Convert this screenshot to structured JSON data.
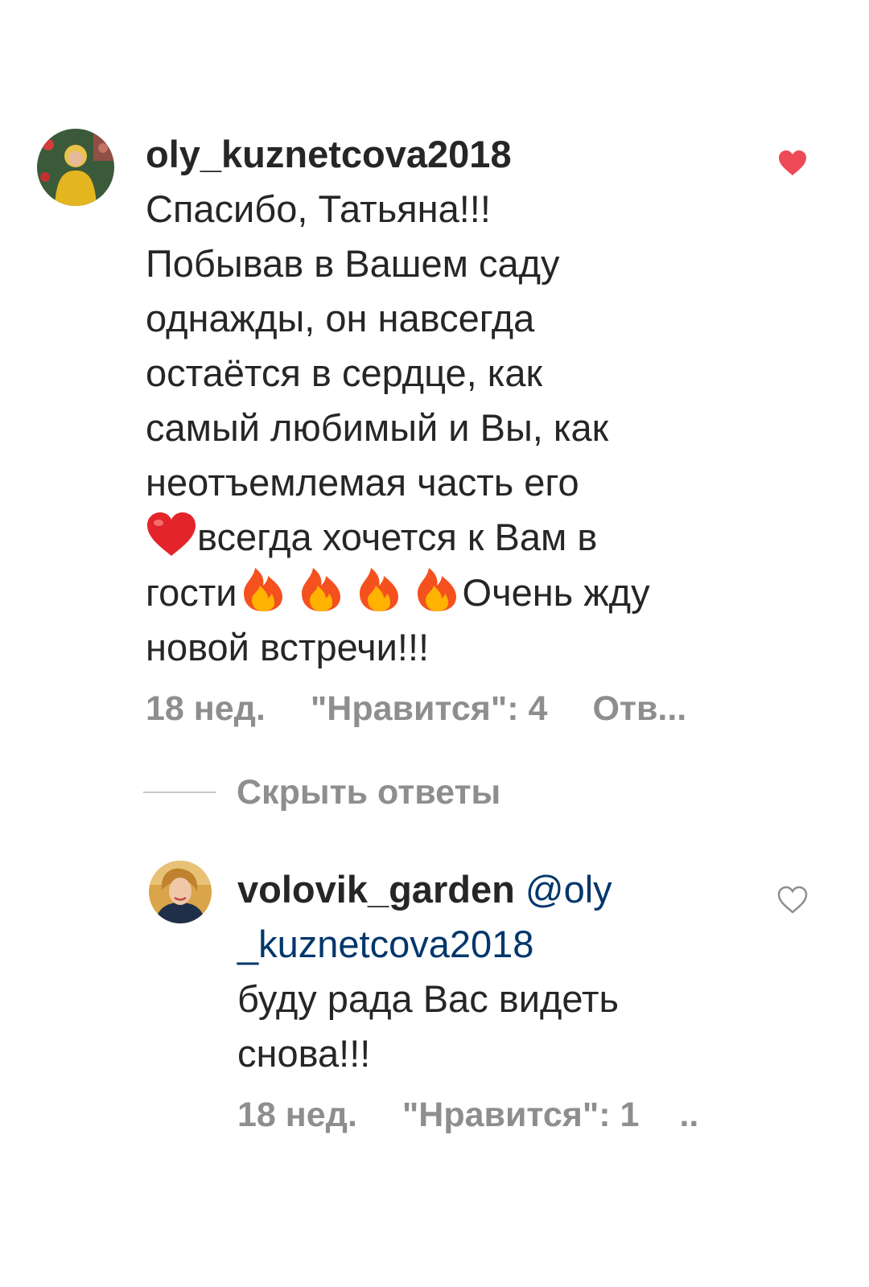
{
  "comments": [
    {
      "username": "oly_kuznetcova2018",
      "lines": [
        "Спасибо, Татьяна!!!",
        "Побывав в Вашем саду",
        "однажды, он навсегда",
        "остаётся в сердце, как",
        "самый любимый и Вы, как",
        "неотъемлемая часть его"
      ],
      "line_heart_after": "всегда хочется к Вам в",
      "line_fire_before": "гости",
      "line_fire_after": "Очень жду",
      "last_line": "новой встречи!!!",
      "time": "18 нед.",
      "likes": "\"Нравится\": 4",
      "reply": "Отв...",
      "liked": true,
      "avatar_icon": "user-avatar-icon"
    },
    {
      "username": "volovik_garden",
      "mention_1": "@oly",
      "mention_2": "_kuznetcova2018",
      "lines": [
        "буду рада Вас видеть",
        "снова!!!"
      ],
      "time": "18 нед.",
      "likes": "\"Нравится\": 1",
      "reply": "..",
      "liked": false,
      "avatar_icon": "user-avatar-icon"
    }
  ],
  "hide_replies_label": "Скрыть ответы",
  "colors": {
    "text": "#262626",
    "secondary": "#8e8e8e",
    "mention": "#00376b",
    "like_active": "#ed4956"
  },
  "icons": {
    "heart_filled": "heart-filled-icon",
    "heart_outline": "heart-outline-icon",
    "red_heart_emoji": "red-heart-emoji-icon",
    "fire_emoji": "fire-emoji-icon"
  }
}
